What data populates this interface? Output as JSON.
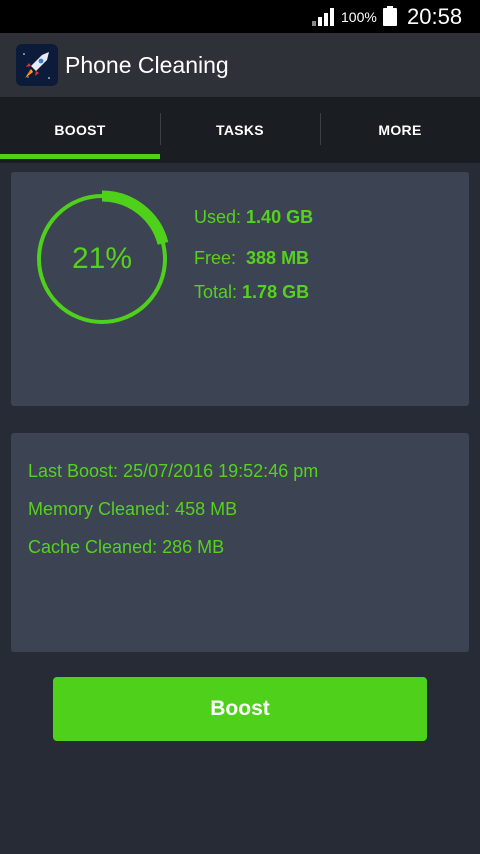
{
  "status_bar": {
    "battery": "100%",
    "time": "20:58"
  },
  "app": {
    "title": "Phone Cleaning",
    "icon": "rocket-icon"
  },
  "tabs": [
    {
      "label": "BOOST",
      "active": true
    },
    {
      "label": "TASKS",
      "active": false
    },
    {
      "label": "MORE",
      "active": false
    }
  ],
  "memory": {
    "percent_label": "21%",
    "percent_value": 0.21,
    "used_label": "Used:",
    "used_value": "1.40 GB",
    "free_label": "Free:",
    "free_value": "388 MB",
    "total_label": "Total:",
    "total_value": "1.78 GB"
  },
  "info": {
    "last_boost": "Last Boost: 25/07/2016 19:52:46 pm",
    "memory_cleaned": "Memory Cleaned: 458 MB",
    "cache_cleaned": "Cache Cleaned: 286 MB"
  },
  "boost_button": "Boost",
  "colors": {
    "accent": "#4fd11c",
    "card": "#3c4453",
    "background": "#262b35"
  }
}
